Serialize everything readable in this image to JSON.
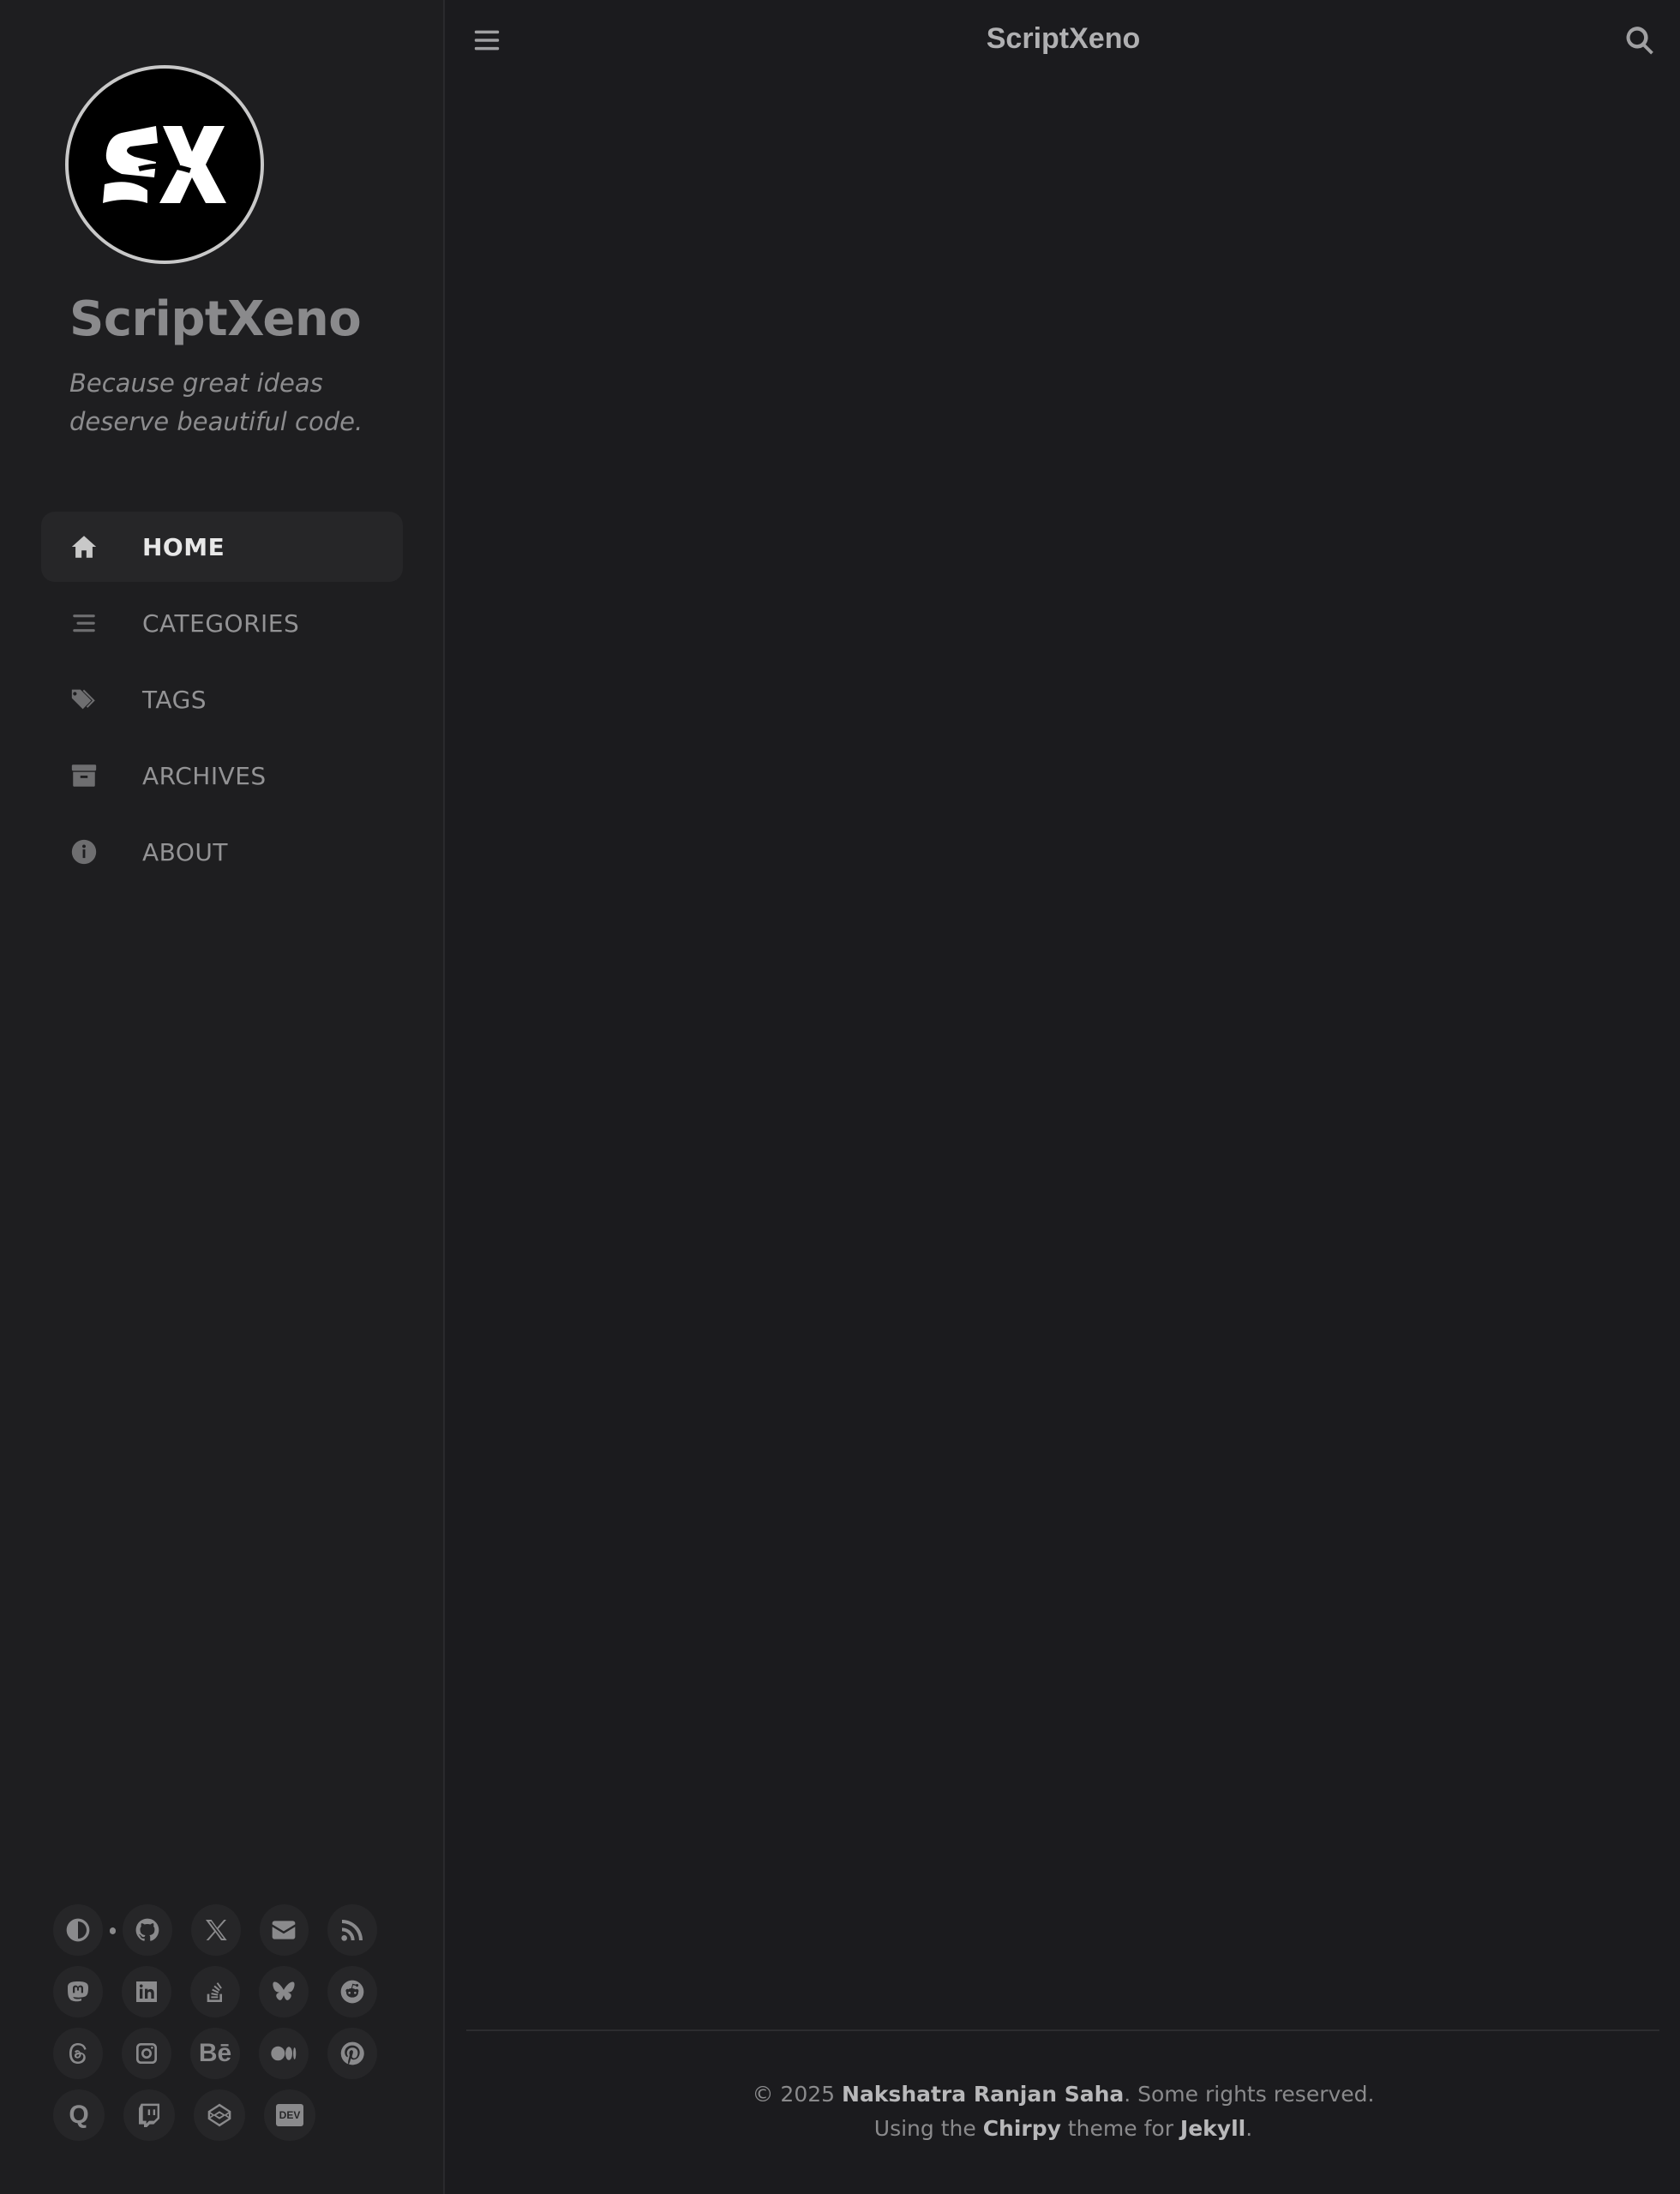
{
  "sidebar": {
    "site_title": "ScriptXeno",
    "subtitle": "Because great ideas deserve beautiful code.",
    "nav": [
      {
        "label": "HOME",
        "icon": "home-icon",
        "active": true
      },
      {
        "label": "CATEGORIES",
        "icon": "stream-icon"
      },
      {
        "label": "TAGS",
        "icon": "tags-icon"
      },
      {
        "label": "ARCHIVES",
        "icon": "archive-icon"
      },
      {
        "label": "ABOUT",
        "icon": "info-circle-icon"
      }
    ],
    "social": [
      "theme-toggle-icon",
      "github-icon",
      "x-twitter-icon",
      "email-icon",
      "rss-icon",
      "mastodon-icon",
      "linkedin-icon",
      "stack-overflow-icon",
      "bluesky-icon",
      "reddit-icon",
      "threads-icon",
      "instagram-icon",
      "behance-icon",
      "medium-icon",
      "pinterest-icon",
      "quora-icon",
      "twitch-icon",
      "codepen-icon",
      "dev-icon"
    ],
    "behance_text": "Bē",
    "quora_text": "Q",
    "dev_text": "DEV"
  },
  "topbar": {
    "title": "ScriptXeno"
  },
  "footer": {
    "copyright_prefix": "© 2025 ",
    "author": "Nakshatra Ranjan Saha",
    "copyright_suffix": ". Some rights reserved.",
    "using_prefix": "Using the ",
    "theme": "Chirpy",
    "theme_for": " theme for ",
    "engine": "Jekyll",
    "end": "."
  }
}
